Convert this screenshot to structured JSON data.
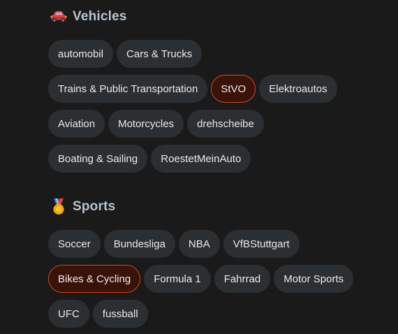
{
  "sections": [
    {
      "id": "vehicles",
      "icon": "car-icon",
      "title": "Vehicles",
      "rows": [
        [
          {
            "label": "automobil",
            "selected": false
          },
          {
            "label": "Cars & Trucks",
            "selected": false
          }
        ],
        [
          {
            "label": "Trains & Public Transportation",
            "selected": false
          },
          {
            "label": "StVO",
            "selected": true
          },
          {
            "label": "Elektroautos",
            "selected": false
          }
        ],
        [
          {
            "label": "Aviation",
            "selected": false
          },
          {
            "label": "Motorcycles",
            "selected": false
          },
          {
            "label": "drehscheibe",
            "selected": false
          }
        ],
        [
          {
            "label": "Boating & Sailing",
            "selected": false
          },
          {
            "label": "RoestetMeinAuto",
            "selected": false
          }
        ]
      ]
    },
    {
      "id": "sports",
      "icon": "medal-icon",
      "title": "Sports",
      "rows": [
        [
          {
            "label": "Soccer",
            "selected": false
          },
          {
            "label": "Bundesliga",
            "selected": false
          },
          {
            "label": "NBA",
            "selected": false
          },
          {
            "label": "VfBStuttgart",
            "selected": false
          }
        ],
        [
          {
            "label": "Bikes & Cycling",
            "selected": true
          },
          {
            "label": "Formula 1",
            "selected": false
          },
          {
            "label": "Fahrrad",
            "selected": false
          },
          {
            "label": "Motor Sports",
            "selected": false
          }
        ],
        [
          {
            "label": "UFC",
            "selected": false
          },
          {
            "label": "fussball",
            "selected": false
          }
        ]
      ]
    }
  ],
  "colors": {
    "background": "#1a1a1b",
    "chip_bg": "#2b2f31",
    "chip_selected_bg": "#3a1308",
    "chip_selected_border": "#d5471c",
    "title": "#b9c3cc"
  }
}
